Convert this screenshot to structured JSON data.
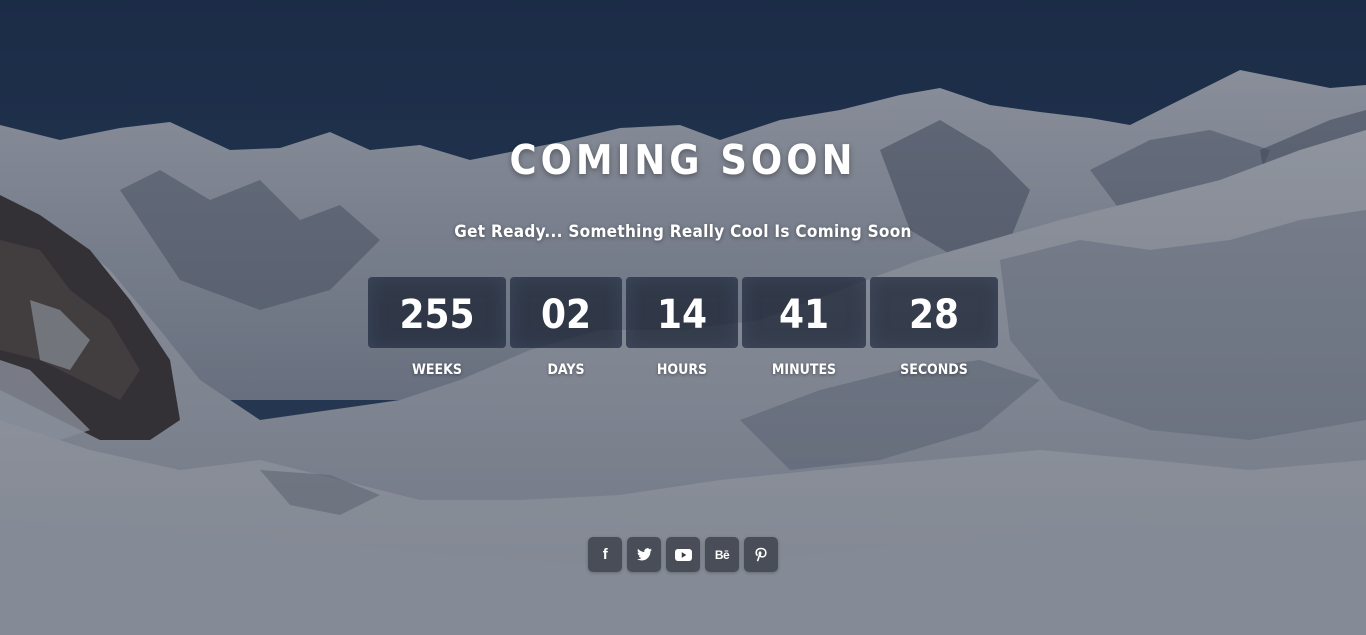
{
  "hero": {
    "title": "COMING SOON",
    "subtitle": "Get Ready... Something Really Cool Is Coming Soon"
  },
  "countdown": [
    {
      "value": "255",
      "label": "WEEKS"
    },
    {
      "value": "02",
      "label": "DAYS"
    },
    {
      "value": "14",
      "label": "HOURS"
    },
    {
      "value": "41",
      "label": "MINUTES"
    },
    {
      "value": "28",
      "label": "SECONDS"
    }
  ],
  "social": [
    {
      "name": "facebook",
      "icon": "facebook-icon",
      "glyph": "f"
    },
    {
      "name": "twitter",
      "icon": "twitter-icon",
      "glyph": ""
    },
    {
      "name": "youtube",
      "icon": "youtube-icon",
      "glyph": ""
    },
    {
      "name": "behance",
      "icon": "behance-icon",
      "glyph": "Bē"
    },
    {
      "name": "pinterest",
      "icon": "pinterest-icon",
      "glyph": ""
    }
  ],
  "colors": {
    "text": "#ffffff",
    "sky": "#203656",
    "counter_box": "#182030",
    "social_button": "#373c46"
  }
}
